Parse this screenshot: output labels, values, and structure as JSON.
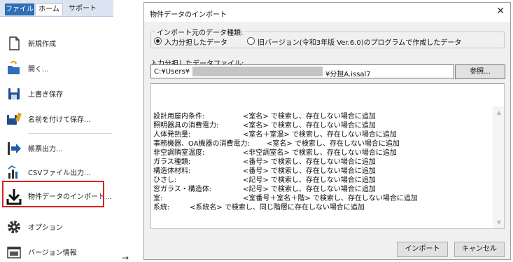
{
  "ribbon": {
    "tabs": [
      "ファイル",
      "ホーム",
      "サポート"
    ]
  },
  "menu": {
    "items": [
      {
        "label": "新規作成",
        "icon": "new-document-icon"
      },
      {
        "label": "開く...",
        "icon": "open-folder-icon"
      },
      {
        "label": "上書き保存",
        "icon": "save-icon"
      },
      {
        "label": "名前を付けて保存...",
        "icon": "save-as-icon"
      },
      {
        "label": "帳票出力...",
        "icon": "report-output-icon"
      },
      {
        "label": "CSVファイル出力...",
        "icon": "csv-export-icon"
      },
      {
        "label": "物件データのインポート...",
        "icon": "import-download-icon"
      },
      {
        "label": "オプション",
        "icon": "gear-icon"
      },
      {
        "label": "バージョン情報",
        "icon": "version-info-icon"
      }
    ]
  },
  "arrow": "→",
  "dialog": {
    "title": "物件データのインポート",
    "close": "✕",
    "source_group": {
      "legend": "インポート元のデータ種類:",
      "options": [
        {
          "label": "入力分担したデータ",
          "selected": true
        },
        {
          "label": "旧バージョン(令和3年版 Ver.6.0)のプログラムで作成したデータ",
          "selected": false
        }
      ]
    },
    "file_field": {
      "label": "入力分担したデータファイル:",
      "prefix": "C:¥Users¥",
      "suffix": "¥分担A.issal7",
      "browse": "参照..."
    },
    "rules": [
      {
        "key": "設計用屋内条件:",
        "value": "<室名> で検索し、存在しない場合に追加"
      },
      {
        "key": "照明器具の消費電力:",
        "value": "<室名> で検索し、存在しない場合に追加"
      },
      {
        "key": "人体発熱量:",
        "value": "<室名＋室温> で検索し、存在しない場合に追加"
      },
      {
        "key": "事務機器、OA機器の消費電力:",
        "value": "<室名> で検索し、存在しない場合に追加"
      },
      {
        "key": "非空調隣室温度:",
        "value": "<非空調室名> で検索し、存在しない場合に追加"
      },
      {
        "key": "ガラス種類:",
        "value": "<番号> で検索し、存在しない場合に追加"
      },
      {
        "key": "構造体材料:",
        "value": "<番号> で検索し、存在しない場合に追加"
      },
      {
        "key": "ひさし:",
        "value": "<記号> で検索し、存在しない場合に追加"
      },
      {
        "key": "窓ガラス・構造体:",
        "value": "<記号> で検索し、存在しない場合に追加"
      },
      {
        "key": "室:",
        "value": "<室番号＋室名＋階> で検索し、存在しない場合に追加"
      },
      {
        "key": "系統:",
        "value": "<系統名> で検索し、同じ階層に存在しない場合に追加"
      }
    ],
    "buttons": {
      "import": "インポート",
      "cancel": "キャンセル"
    }
  }
}
